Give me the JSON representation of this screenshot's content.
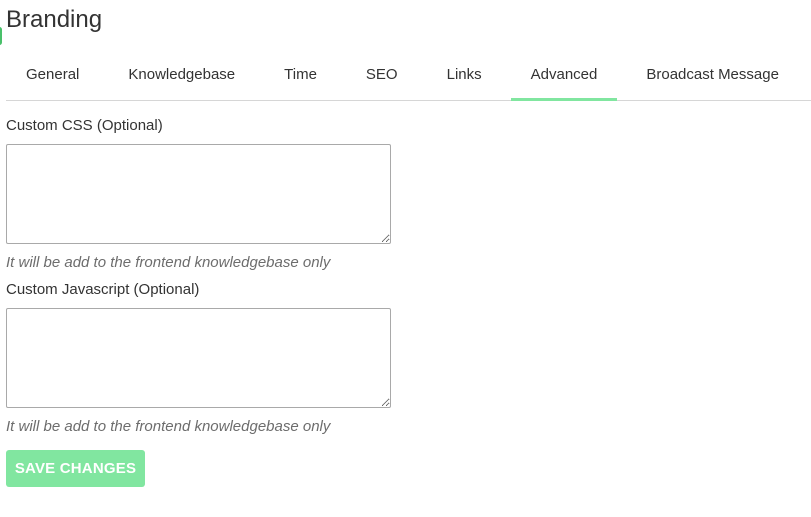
{
  "page": {
    "title": "Branding"
  },
  "tabs": [
    {
      "label": "General",
      "active": false
    },
    {
      "label": "Knowledgebase",
      "active": false
    },
    {
      "label": "Time",
      "active": false
    },
    {
      "label": "SEO",
      "active": false
    },
    {
      "label": "Links",
      "active": false
    },
    {
      "label": "Advanced",
      "active": true
    },
    {
      "label": "Broadcast Message",
      "active": false
    }
  ],
  "form": {
    "custom_css": {
      "label": "Custom CSS (Optional)",
      "value": "",
      "help": "It will be add to the frontend knowledgebase only"
    },
    "custom_js": {
      "label": "Custom Javascript (Optional)",
      "value": "",
      "help": "It will be add to the frontend knowledgebase only"
    },
    "save_label": "SAVE CHANGES"
  },
  "colors": {
    "accent": "#81e6a0",
    "text": "#333333",
    "muted": "#6d6d6d",
    "divider": "#d6d6d6"
  }
}
